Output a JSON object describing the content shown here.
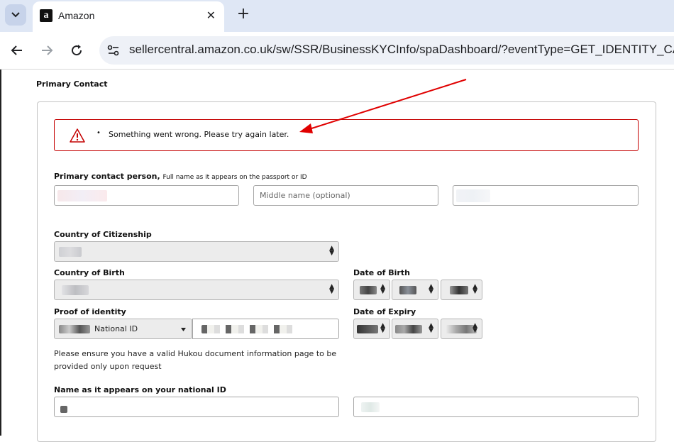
{
  "browser": {
    "tab_title": "Amazon",
    "tab_close": "✕",
    "new_tab": "+",
    "url": "sellercentral.amazon.co.uk/sw/SSR/BusinessKYCInfo/spaDashboard/?eventType=GET_IDENTITY_CA"
  },
  "form": {
    "section_title": "Primary Contact",
    "alert": {
      "bullet": "•",
      "message": "Something went wrong. Please try again later.",
      "color": "#c40000"
    },
    "primary_contact": {
      "label": "Primary contact person,",
      "sublabel": "Full name as it appears on the passport or ID",
      "middle_name_placeholder": "Middle name (optional)"
    },
    "citizenship": {
      "label": "Country of Citizenship"
    },
    "birth_country": {
      "label": "Country of Birth"
    },
    "dob": {
      "label": "Date of Birth"
    },
    "proof": {
      "label": "Proof of identity",
      "id_type": "National ID"
    },
    "expiry": {
      "label": "Date of Expiry"
    },
    "help_text": "Please ensure you have a valid Hukou document information page to be provided only upon request",
    "name_on_id": {
      "label": "Name as it appears on your national ID"
    }
  },
  "annotation": {
    "arrow_color": "#e00000"
  }
}
